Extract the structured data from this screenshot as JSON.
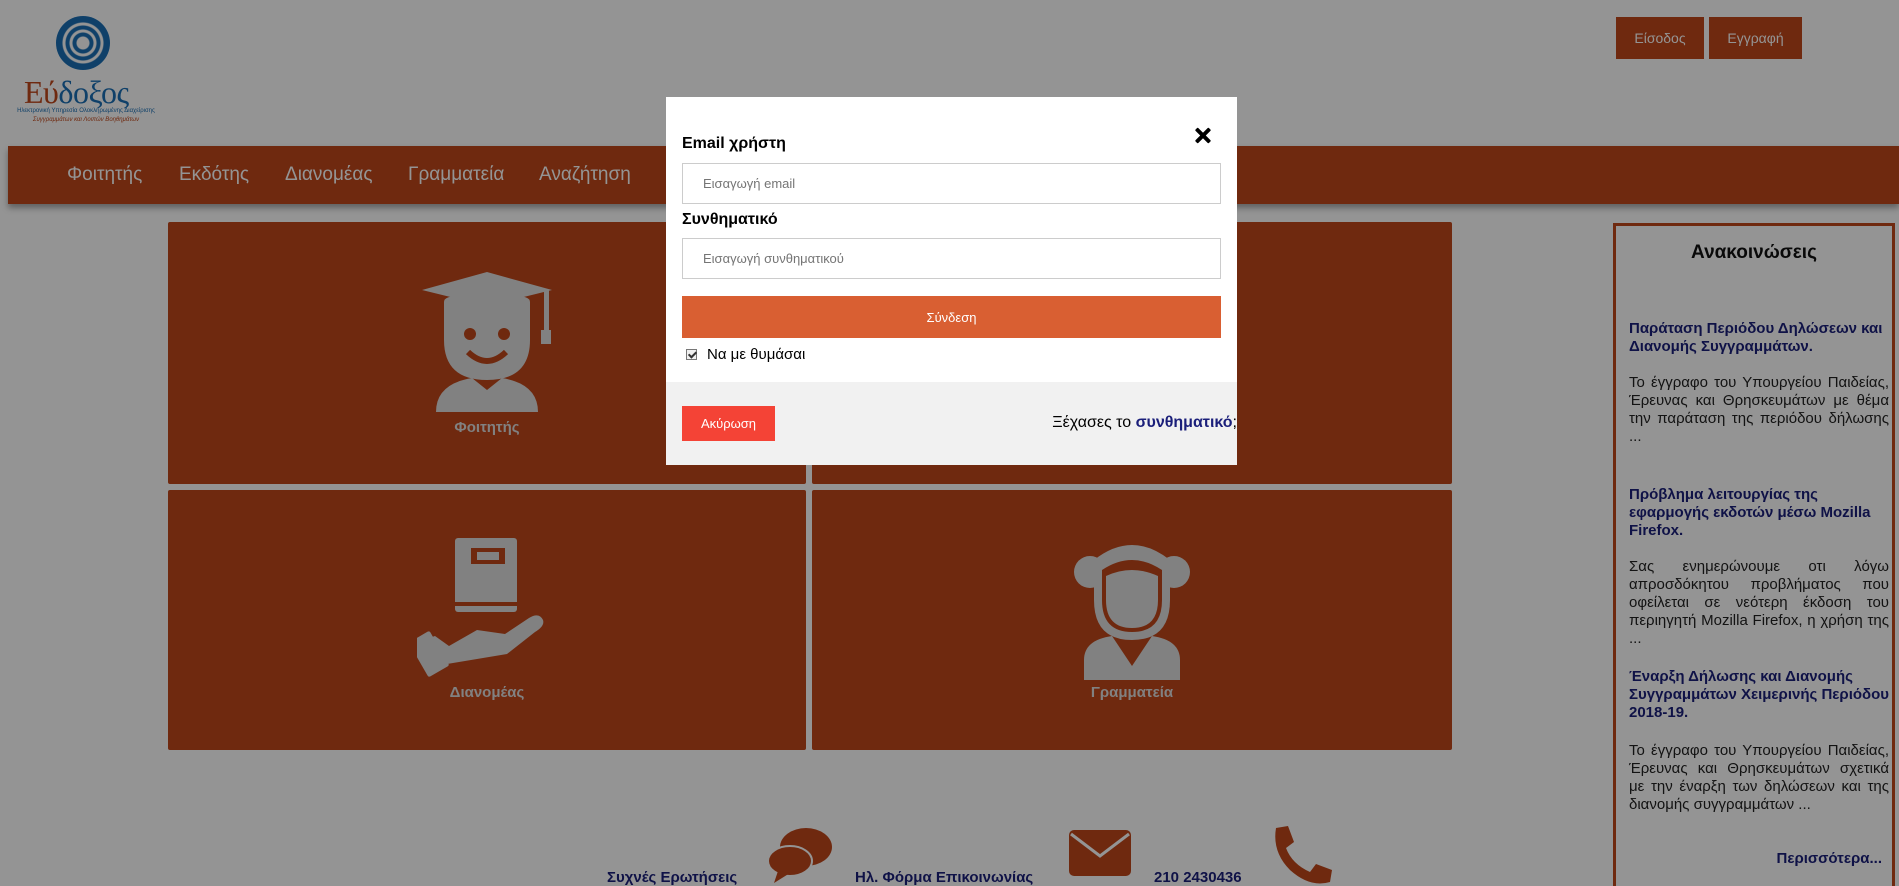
{
  "logo": {
    "word_part1": "Εύ",
    "word_part2": "δοξος",
    "subtitle_line1": "Ηλεκτρονική Υπηρεσία Ολοκληρωμένης Διαχείρισης",
    "subtitle_line2": "Συγγραμμάτων και Λοιπών Βοηθημάτων"
  },
  "header": {
    "login_label": "Είσοδος",
    "register_label": "Εγγραφή"
  },
  "nav": {
    "items": [
      "Φοιτητής",
      "Εκδότης",
      "Διανομέας",
      "Γραμματεία",
      "Αναζήτηση"
    ]
  },
  "tiles": {
    "student": "Φοιτητής",
    "distributor": "Διανομέας",
    "secretariat": "Γραμματεία"
  },
  "announcements": {
    "title": "Ανακοινώσεις",
    "items": [
      {
        "heading": "Παράταση Περιόδου Δηλώσεων και Διανομής Συγγραμμάτων.",
        "body": "Το έγγραφο του Υπουργείου Παιδείας, Έρευνας και Θρησκευμάτων με θέμα την παράταση της περιόδου δήλωσης ..."
      },
      {
        "heading": "Πρόβλημα λειτουργίας της εφαρμογής εκδοτών μέσω Mozilla Firefox.",
        "body": "Σας ενημερώνουμε οτι λόγω απροσδόκητου προβλήματος που οφείλεται σε νεότερη έκδοση του περιηγητή Mozilla Firefox, η χρήση της ..."
      },
      {
        "heading": "Έναρξη Δήλωσης και Διανομής Συγγραμμάτων Χειμερινής Περιόδου 2018-19.",
        "body": "Το έγγραφο του Υπουργείου Παιδείας, Έρευνας και Θρησκευμάτων σχετικά με την έναρξη των δηλώσεων και της διανομής συγγραμμάτων ..."
      }
    ],
    "more_label": "Περισσότερα..."
  },
  "footer": {
    "faq_label": "Συχνές Ερωτήσεις",
    "contact_form_label": "Ηλ. Φόρμα Επικοινωνίας",
    "phone": "210 2430436",
    "faq_icon": "chat-bubbles-icon",
    "mail_icon": "envelope-icon",
    "phone_icon": "phone-icon"
  },
  "modal": {
    "email_label": "Email χρήστη",
    "email_placeholder": "Εισαγωγή email",
    "password_label": "Συνθηματικό",
    "password_placeholder": "Εισαγωγή συνθηματικού",
    "submit_label": "Σύνδεση",
    "remember_label": "Να με θυμάσαι",
    "remember_checked": true,
    "cancel_label": "Ακύρωση",
    "forgot_prefix": "Ξέχασες το ",
    "forgot_link": "συνθηματικό",
    "forgot_suffix": ";"
  },
  "colors": {
    "brand": "#c0471a",
    "submit": "#d95f32",
    "cancel": "#f44336",
    "link": "#1b1f7a"
  }
}
